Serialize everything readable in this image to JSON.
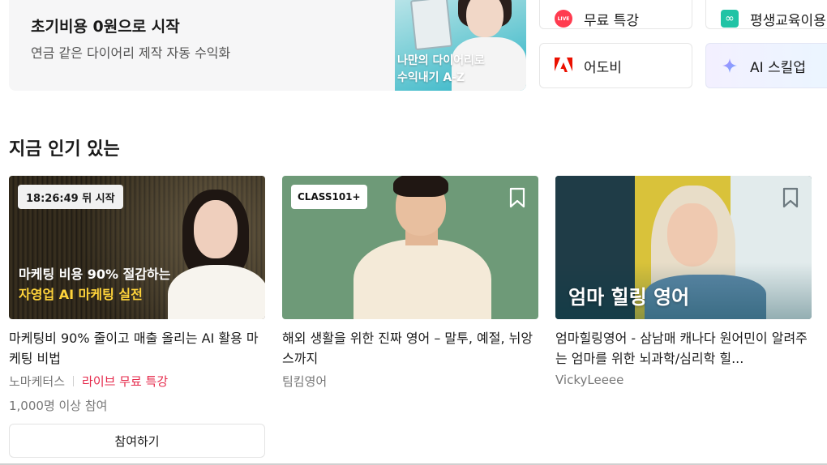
{
  "banner": {
    "title": "초기비용 0원으로 시작",
    "subtitle": "연금 같은 다이어리 제작 자동 수익화",
    "thumb_line1": "나만의 다이어리로",
    "thumb_line2": "수익내기 A-Z"
  },
  "shortcuts": {
    "live": {
      "label": "무료 특강",
      "icon": "live-icon",
      "badge": "LIVE"
    },
    "lifelong": {
      "label": "평생교육이용",
      "icon": "infinity-icon",
      "glyph": "∞"
    },
    "adobe": {
      "label": "어도비",
      "icon": "adobe-icon"
    },
    "ai": {
      "label": "AI 스킬업",
      "icon": "sparkle-icon"
    }
  },
  "section": {
    "title": "지금 인기 있는"
  },
  "cards": [
    {
      "badge": "18:26:49 뒤 시작",
      "thumb_line1": "마케팅 비용 90% 절감하는",
      "thumb_line2": "자영업 AI 마케팅 실전",
      "title": "마케팅비 90% 줄이고 매출 올리는 AI 활용 마케팅 비법",
      "creator": "노마케터스",
      "tag": "라이브 무료 특강",
      "count": "1,000명 이상 참여",
      "button": "참여하기"
    },
    {
      "badge": "CLASS101+",
      "title": "해외 생활을 위한 진짜 영어 – 말투, 예절, 뉘앙스까지",
      "creator": "팀킴영어"
    },
    {
      "thumb_title": "엄마 힐링 영어",
      "title": "엄마힐링영어 - 삼남매 캐나다 원어민이 알려주는 엄마를 위한 뇌과학/심리학 힐...",
      "creator": "VickyLeeee"
    }
  ],
  "colors": {
    "accent_red": "#e5284a",
    "live_red": "#ff3b4f",
    "adobe_red": "#eb1000",
    "highlight_yellow": "#ffd43b",
    "teal": "#20c3a5"
  }
}
